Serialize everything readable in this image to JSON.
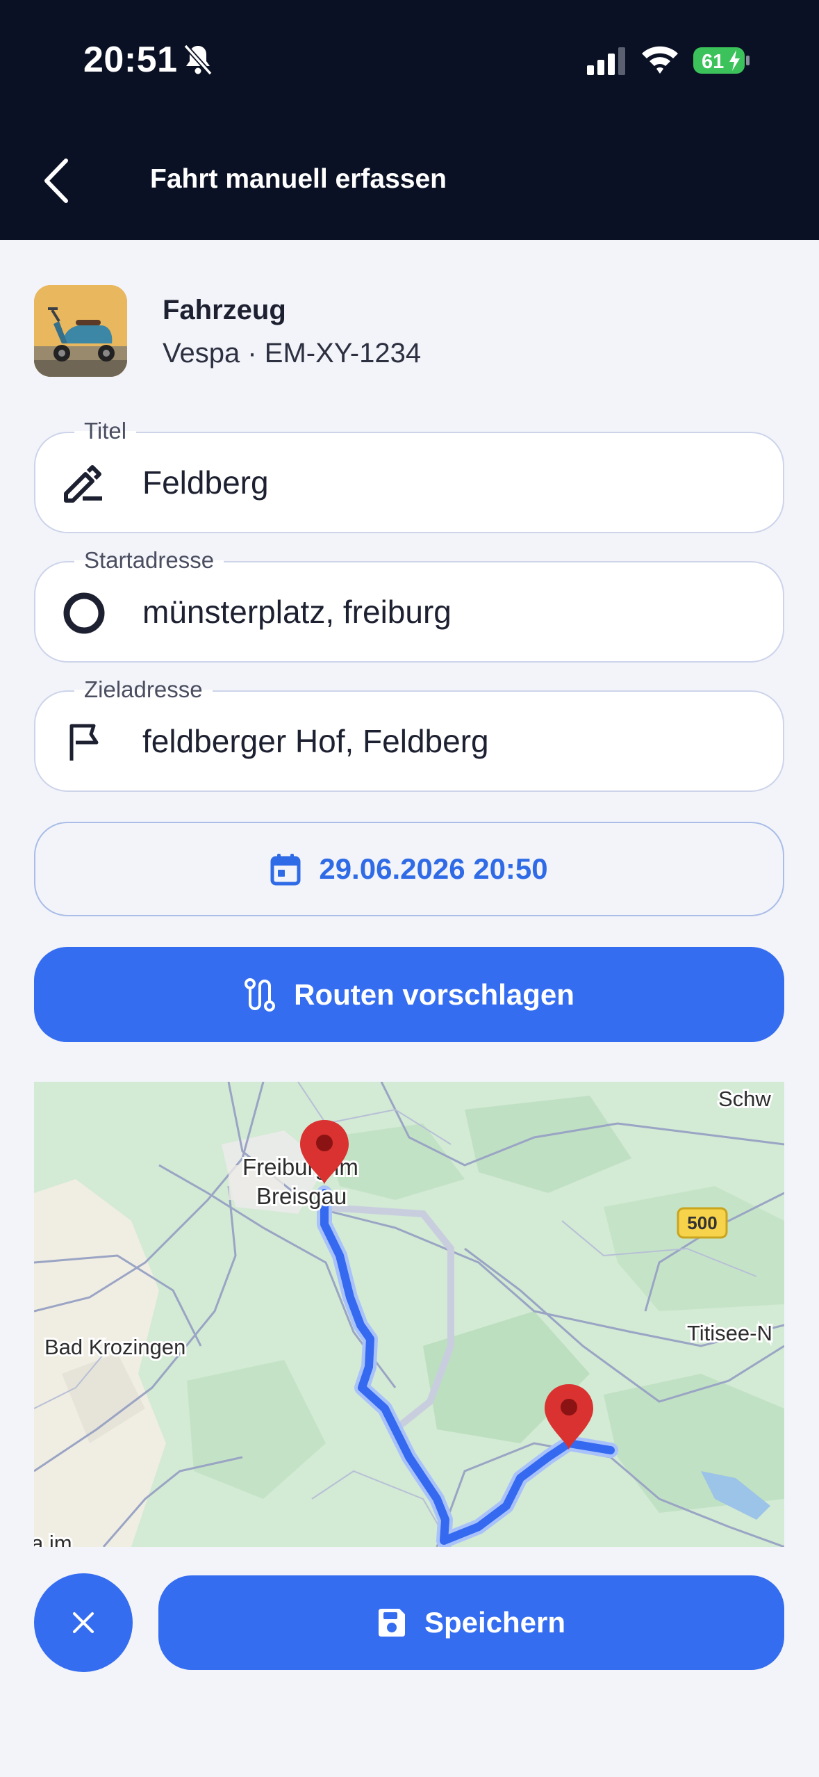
{
  "status_bar": {
    "time": "20:51",
    "battery": "61"
  },
  "header": {
    "title": "Fahrt manuell erfassen"
  },
  "vehicle": {
    "label": "Fahrzeug",
    "value": "Vespa · EM-XY-1234"
  },
  "fields": {
    "title": {
      "label": "Titel",
      "value": "Feldberg"
    },
    "start": {
      "label": "Startadresse",
      "value": "münsterplatz, freiburg"
    },
    "destination": {
      "label": "Zieladresse",
      "value": "feldberger Hof, Feldberg"
    }
  },
  "date_button": {
    "label": "29.06.2026 20:50"
  },
  "routes_button": {
    "label": "Routen vorschlagen"
  },
  "map": {
    "labels": {
      "freiburg_line1": "Freiburg im",
      "freiburg_line2": "Breisgau",
      "bad_krozingen": "Bad Krozingen",
      "titisee": "Titisee-N",
      "schw": "Schw",
      "road_500": "500",
      "bottom_left": "a im"
    }
  },
  "actions": {
    "save_label": "Speichern"
  },
  "colors": {
    "header_bg": "#0b1124",
    "accent": "#356df0",
    "route": "#3569f0",
    "marker": "#d93230"
  },
  "icons": [
    "bell-slash-icon",
    "signal-icon",
    "wifi-icon",
    "battery-icon",
    "back-chevron-icon",
    "pen-icon",
    "circle-icon",
    "flag-icon",
    "calendar-icon",
    "route-icon",
    "close-icon",
    "save-icon",
    "map-pin-icon"
  ]
}
